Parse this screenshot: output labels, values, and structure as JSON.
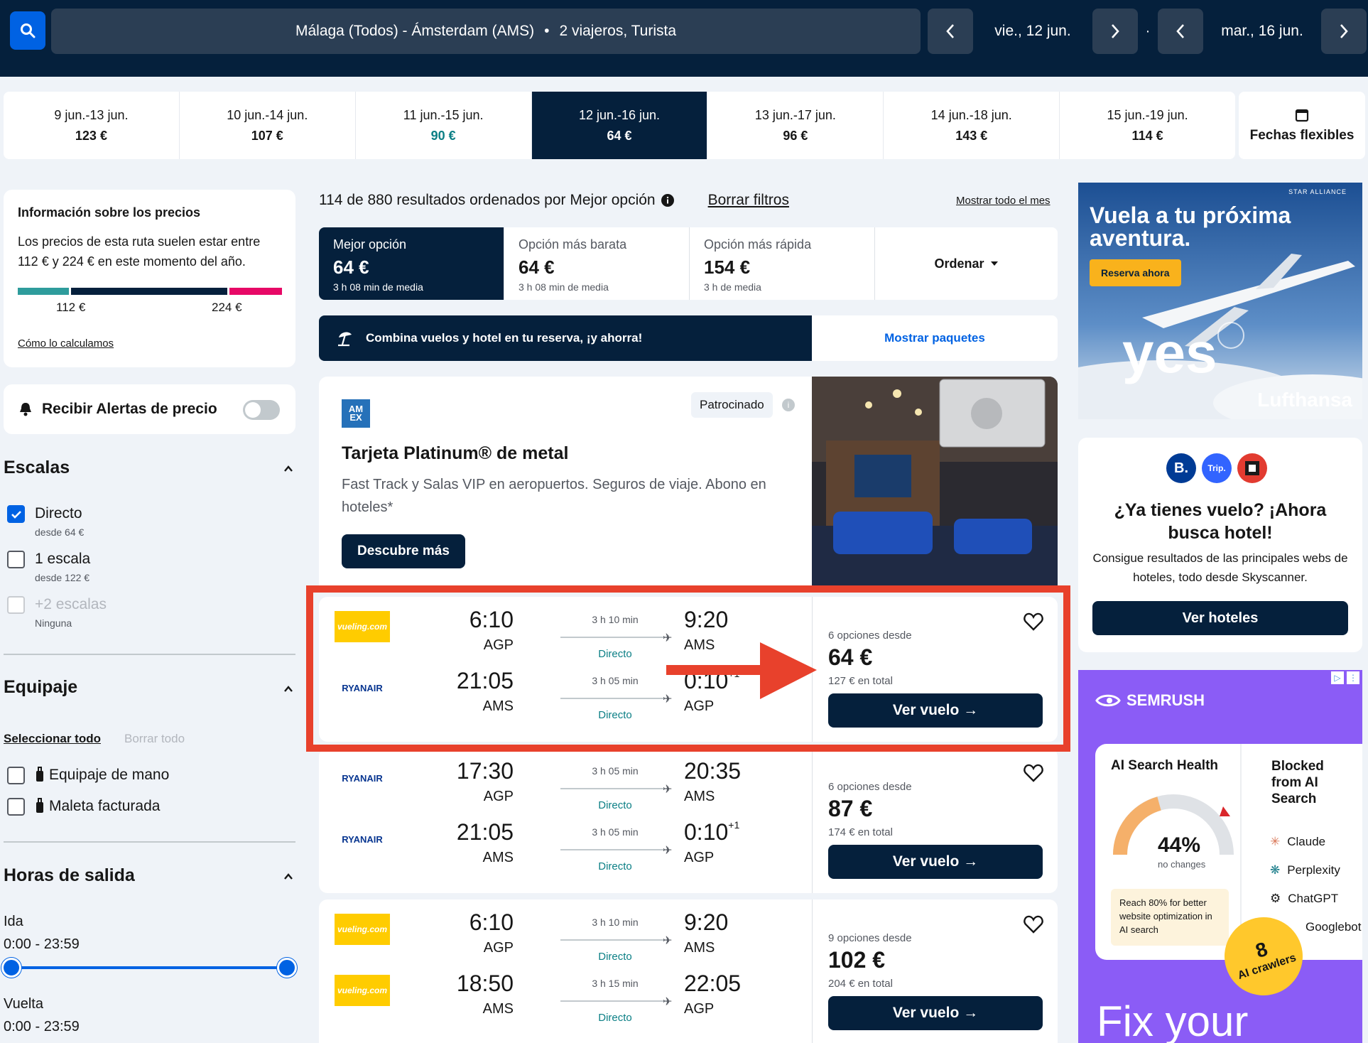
{
  "header": {
    "route": "Málaga (Todos) - Ámsterdam (AMS)",
    "dot": "•",
    "travellers": "2 viajeros, Turista",
    "depart_date": "vie., 12 jun.",
    "return_date": "mar., 16 jun.",
    "separator": "·"
  },
  "date_strip": [
    {
      "label": "9 jun.-13 jun.",
      "price": "123 €"
    },
    {
      "label": "10 jun.-14 jun.",
      "price": "107 €"
    },
    {
      "label": "11 jun.-15 jun.",
      "price": "90 €"
    },
    {
      "label": "12 jun.-16 jun.",
      "price": "64 €"
    },
    {
      "label": "13 jun.-17 jun.",
      "price": "96 €"
    },
    {
      "label": "14 jun.-18 jun.",
      "price": "143 €"
    },
    {
      "label": "15 jun.-19 jun.",
      "price": "114 €"
    }
  ],
  "flexible_dates": "Fechas flexibles",
  "price_info": {
    "title": "Información sobre los precios",
    "text": "Los precios de esta ruta suelen estar entre 112 € y 224 € en este momento del año.",
    "low": "112 €",
    "high": "224 €",
    "link": "Cómo lo calculamos"
  },
  "alerts": {
    "label": "Recibir Alertas de precio"
  },
  "stops": {
    "title": "Escalas",
    "items": [
      {
        "label": "Directo",
        "sub": "desde 64 €"
      },
      {
        "label": "1 escala",
        "sub": "desde 122 €"
      },
      {
        "label": "+2 escalas",
        "sub": "Ninguna"
      }
    ]
  },
  "baggage": {
    "title": "Equipaje",
    "select_all": "Seleccionar todo",
    "clear_all": "Borrar todo",
    "items": [
      "Equipaje de mano",
      "Maleta facturada"
    ]
  },
  "departure_times": {
    "title": "Horas de salida",
    "outbound_label": "Ida",
    "outbound_range": "0:00 - 23:59",
    "return_label": "Vuelta",
    "return_range": "0:00 - 23:59"
  },
  "results": {
    "summary": "114 de 880 resultados ordenados por Mejor opción",
    "clear_filters": "Borrar filtros",
    "show_month": "Mostrar todo el mes"
  },
  "sort_options": [
    {
      "label": "Mejor opción",
      "price": "64 €",
      "sub": "3 h 08 min de media"
    },
    {
      "label": "Opción más barata",
      "price": "64 €",
      "sub": "3 h 08 min de media"
    },
    {
      "label": "Opción más rápida",
      "price": "154 €",
      "sub": "3 h de media"
    }
  ],
  "order_label": "Ordenar",
  "combo": {
    "text": "Combina vuelos y hotel en tu reserva, ¡y ahorra!",
    "button": "Mostrar paquetes"
  },
  "ad": {
    "logo": "AM EX",
    "sponsored": "Patrocinado",
    "title": "Tarjeta Platinum® de metal",
    "description": "Fast Track y Salas VIP en aeropuertos. Seguros de viaje. Abono en hoteles*",
    "button": "Descubre más"
  },
  "flights": [
    {
      "legs": [
        {
          "airline": "vueling.com",
          "dep": "6:10",
          "dep_code": "AGP",
          "dur": "3 h 10 min",
          "stops": "Directo",
          "arr": "9:20",
          "arr_code": "AMS",
          "plus": ""
        },
        {
          "airline": "RYANAIR",
          "dep": "21:05",
          "dep_code": "AMS",
          "dur": "3 h 05 min",
          "stops": "Directo",
          "arr": "0:10",
          "arr_code": "AGP",
          "plus": "+1"
        }
      ],
      "options": "6 opciones desde",
      "price": "64 €",
      "total": "127 € en total",
      "button": "Ver vuelo →"
    },
    {
      "legs": [
        {
          "airline": "RYANAIR",
          "dep": "17:30",
          "dep_code": "AGP",
          "dur": "3 h 05 min",
          "stops": "Directo",
          "arr": "20:35",
          "arr_code": "AMS",
          "plus": ""
        },
        {
          "airline": "RYANAIR",
          "dep": "21:05",
          "dep_code": "AMS",
          "dur": "3 h 05 min",
          "stops": "Directo",
          "arr": "0:10",
          "arr_code": "AGP",
          "plus": "+1"
        }
      ],
      "options": "6 opciones desde",
      "price": "87 €",
      "total": "174 € en total",
      "button": "Ver vuelo →"
    },
    {
      "legs": [
        {
          "airline": "vueling.com",
          "dep": "6:10",
          "dep_code": "AGP",
          "dur": "3 h 10 min",
          "stops": "Directo",
          "arr": "9:20",
          "arr_code": "AMS",
          "plus": ""
        },
        {
          "airline": "vueling.com",
          "dep": "18:50",
          "dep_code": "AMS",
          "dur": "3 h 15 min",
          "stops": "Directo",
          "arr": "22:05",
          "arr_code": "AGP",
          "plus": ""
        }
      ],
      "options": "9 opciones desde",
      "price": "102 €",
      "total": "204 € en total",
      "button": "Ver vuelo →"
    }
  ],
  "lufthansa_ad": {
    "alliance": "STAR ALLIANCE",
    "headline": "Vuela a tu próxima aventura.",
    "button": "Reserva ahora",
    "slogan": "yes",
    "brand": "Lufthansa"
  },
  "hotel_promo": {
    "logos": [
      "B.",
      "Trip."
    ],
    "title": "¿Ya tienes vuelo? ¡Ahora busca hotel!",
    "text": "Consigue resultados de las principales webs de hoteles, todo desde Skyscanner.",
    "button": "Ver hoteles"
  },
  "semrush_ad": {
    "brand": "SEMRUSH",
    "card_title": "AI Search Health",
    "percent": "44%",
    "percent_note": "no changes",
    "tip": "Reach 80% for better website optimization in AI search",
    "blocked_title": "Blocked from AI Search",
    "bots": [
      "Claude",
      "Perplexity",
      "ChatGPT",
      "Googlebot"
    ],
    "badge_num": "8",
    "badge_text": "AI crawlers",
    "tagline": "Fix your"
  },
  "colors": {
    "navy": "#05203c",
    "blue": "#0062e3",
    "teal": "#0b7f85",
    "highlight": "#e8412c"
  }
}
